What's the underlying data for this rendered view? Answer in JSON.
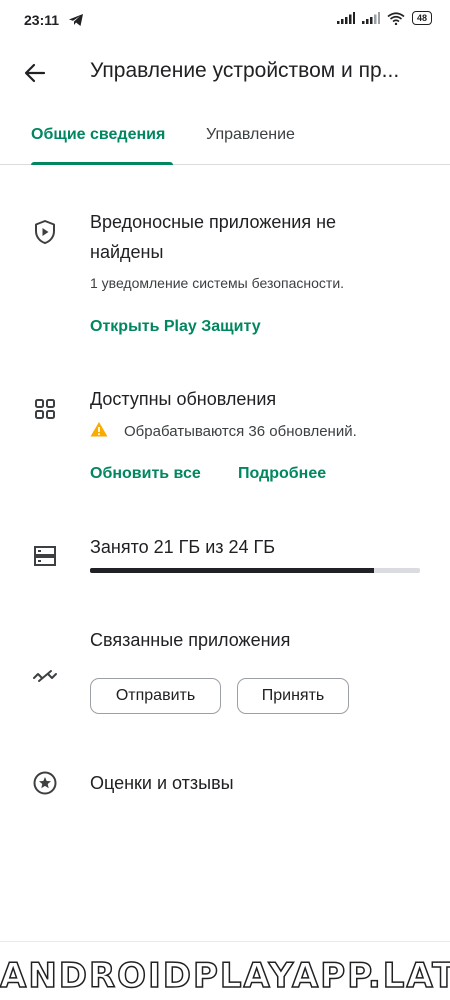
{
  "status_bar": {
    "time": "23:11",
    "battery": "48",
    "icons": [
      "telegram-icon",
      "signal-icon",
      "signal-icon",
      "wifi-icon",
      "battery-icon"
    ]
  },
  "header": {
    "title": "Управление устройством и пр...",
    "back_icon": "arrow-back-icon"
  },
  "tabs": [
    {
      "label": "Общие сведения",
      "active": true
    },
    {
      "label": "Управление",
      "active": false
    }
  ],
  "protect": {
    "icon": "shield-play-icon",
    "title_line1": "Вредоносные приложения не",
    "title_line2": "найдены",
    "subtitle": "1 уведомление системы безопасности.",
    "link": "Открыть Play Защиту"
  },
  "updates": {
    "icon": "apps-grid-icon",
    "title": "Доступны обновления",
    "status_icon": "warning-icon",
    "status": "Обрабатываются 36 обновлений.",
    "update_all": "Обновить все",
    "details": "Подробнее"
  },
  "storage": {
    "icon": "storage-icon",
    "label": "Занято 21 ГБ из 24 ГБ",
    "used_fraction": 0.86
  },
  "share": {
    "icon": "share-apps-icon",
    "title": "Связанные приложения",
    "send": "Отправить",
    "receive": "Принять"
  },
  "ratings": {
    "icon": "star-circle-icon",
    "title": "Оценки и отзывы"
  },
  "watermark": "ANDROIDPLAYAPP.LAT",
  "colors": {
    "accent": "#01875f",
    "text": "#202124",
    "divider": "#dadce0",
    "warning": "#f9ab00"
  }
}
